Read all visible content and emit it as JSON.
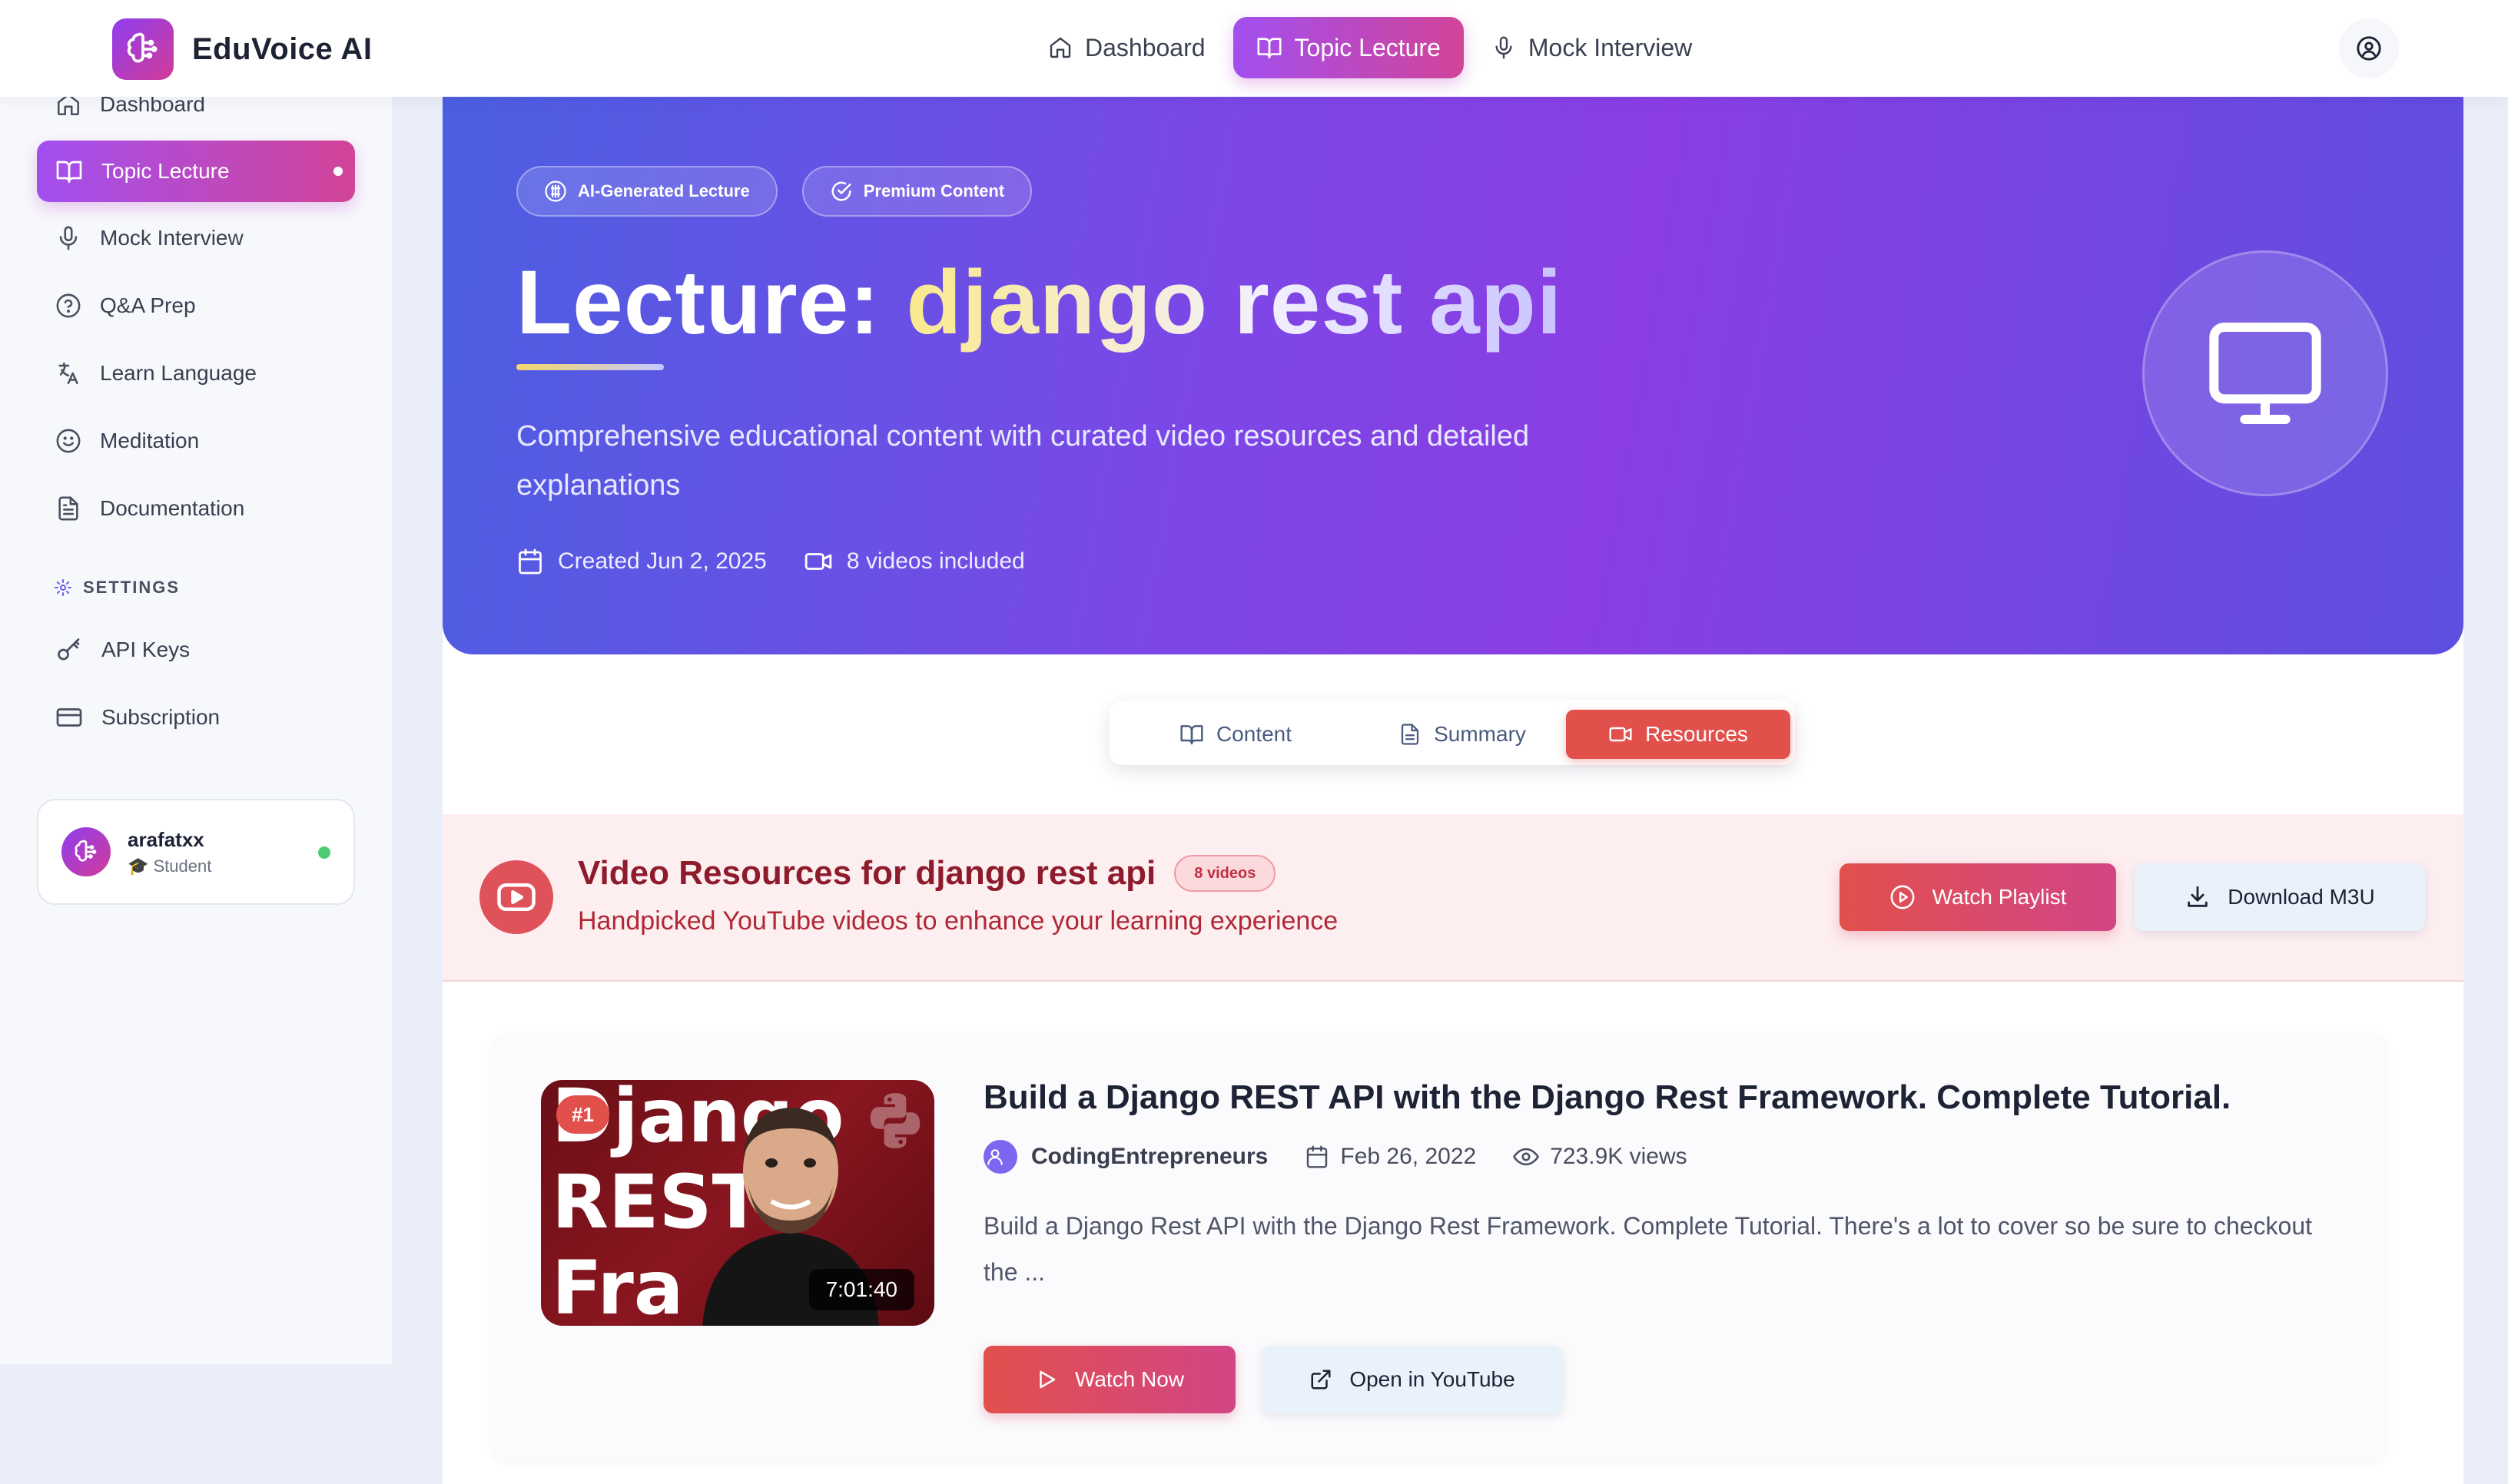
{
  "app": {
    "name": "EduVoice AI"
  },
  "topnav": {
    "items": [
      {
        "label": "Dashboard",
        "icon": "home-icon"
      },
      {
        "label": "Topic Lecture",
        "icon": "book-open-icon",
        "active": true
      },
      {
        "label": "Mock Interview",
        "icon": "microphone-icon"
      }
    ]
  },
  "sidebar": {
    "items": [
      {
        "label": "Dashboard",
        "icon": "home-icon"
      },
      {
        "label": "Topic Lecture",
        "icon": "book-open-icon",
        "active": true
      },
      {
        "label": "Mock Interview",
        "icon": "microphone-icon"
      },
      {
        "label": "Q&A Prep",
        "icon": "help-circle-icon"
      },
      {
        "label": "Learn Language",
        "icon": "translate-icon"
      },
      {
        "label": "Meditation",
        "icon": "smile-icon"
      },
      {
        "label": "Documentation",
        "icon": "document-icon"
      }
    ],
    "settings_label": "SETTINGS",
    "settings_items": [
      {
        "label": "API Keys",
        "icon": "key-icon"
      },
      {
        "label": "Subscription",
        "icon": "credit-card-icon"
      }
    ],
    "user": {
      "name": "arafatxx",
      "role": "🎓 Student",
      "status": "online"
    }
  },
  "hero": {
    "badges": [
      "AI-Generated Lecture",
      "Premium Content"
    ],
    "title_prefix": "Lecture: ",
    "title_topic": "django rest api",
    "description": "Comprehensive educational content with curated video resources and detailed explanations",
    "created": "Created Jun 2, 2025",
    "videos_included": "8 videos included",
    "icon": "monitor-icon"
  },
  "tabs": [
    {
      "label": "Content",
      "icon": "book-open-icon"
    },
    {
      "label": "Summary",
      "icon": "document-icon"
    },
    {
      "label": "Resources",
      "icon": "video-icon",
      "active": true
    }
  ],
  "resources": {
    "title": "Video Resources for django rest api",
    "count_badge": "8 videos",
    "subtitle": "Handpicked YouTube videos to enhance your learning experience",
    "watch_playlist": "Watch Playlist",
    "download_m3u": "Download M3U"
  },
  "videos": [
    {
      "rank": "#1",
      "thumbnail_text": "Django REST Fra",
      "duration": "7:01:40",
      "title": "Build a Django REST API with the Django Rest Framework. Complete Tutorial.",
      "channel": "CodingEntrepreneurs",
      "date": "Feb 26, 2022",
      "views": "723.9K views",
      "description": "Build a Django Rest API with the Django Rest Framework. Complete Tutorial. There's a lot to cover so be sure to checkout the ...",
      "watch_label": "Watch Now",
      "youtube_label": "Open in YouTube"
    }
  ],
  "colors": {
    "accent_gradient_start": "#a24ff0",
    "accent_gradient_end": "#d24498",
    "resource_red": "#e2504c",
    "hero_blue": "#4b5fe2",
    "hero_purple": "#8a3ee3"
  }
}
